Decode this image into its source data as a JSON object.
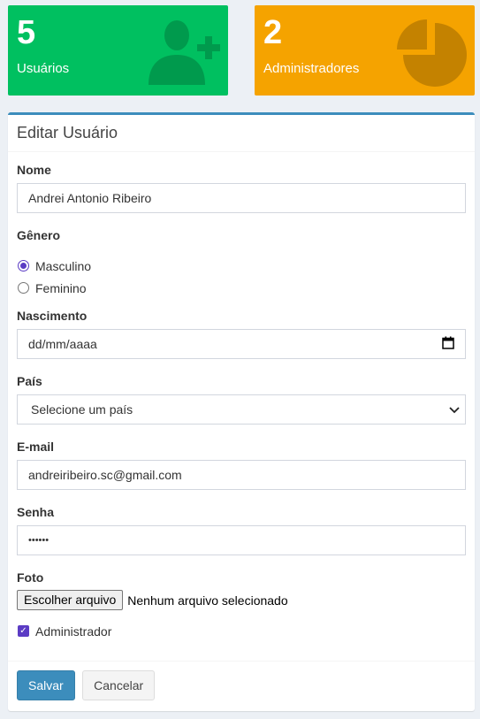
{
  "stats": [
    {
      "value": "5",
      "label": "Usuários",
      "icon": "user-plus-icon",
      "color": "#00c060"
    },
    {
      "value": "2",
      "label": "Administradores",
      "icon": "pie-chart-icon",
      "color": "#f5a300"
    }
  ],
  "form": {
    "title": "Editar Usuário",
    "name_label": "Nome",
    "name_value": "Andrei Antonio Ribeiro",
    "gender_label": "Gênero",
    "gender_options": [
      "Masculino",
      "Feminino"
    ],
    "gender_selected": "Masculino",
    "birth_label": "Nascimento",
    "birth_placeholder": "dd/mm/aaaa",
    "country_label": "País",
    "country_selected": "Selecione um país",
    "email_label": "E-mail",
    "email_value": "andreiribeiro.sc@gmail.com",
    "password_label": "Senha",
    "password_mask": "••••••",
    "photo_label": "Foto",
    "photo_button": "Escolher arquivo",
    "photo_status": "Nenhum arquivo selecionado",
    "admin_label": "Administrador",
    "admin_checked": true
  },
  "actions": {
    "save": "Salvar",
    "cancel": "Cancelar"
  }
}
